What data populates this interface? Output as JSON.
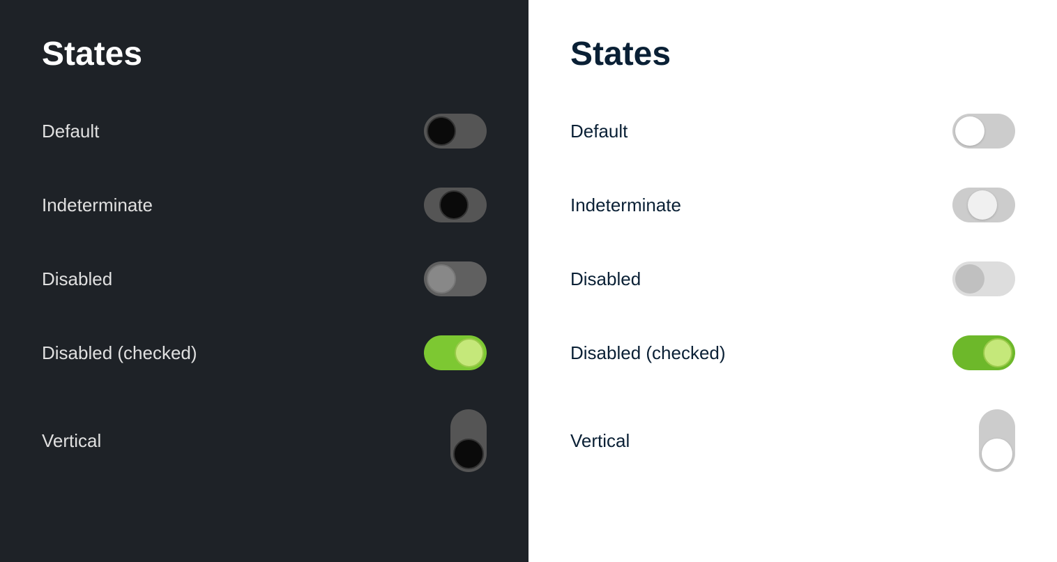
{
  "dark_panel": {
    "title": "States",
    "rows": [
      {
        "label": "Default",
        "toggle_class": "dark-default",
        "type": "horizontal"
      },
      {
        "label": "Indeterminate",
        "toggle_class": "dark-indeterminate",
        "type": "horizontal"
      },
      {
        "label": "Disabled",
        "toggle_class": "dark-disabled",
        "type": "horizontal"
      },
      {
        "label": "Disabled (checked)",
        "toggle_class": "dark-disabled-checked",
        "type": "horizontal"
      },
      {
        "label": "Vertical",
        "toggle_class": "dark-vertical",
        "type": "vertical"
      }
    ]
  },
  "light_panel": {
    "title": "States",
    "rows": [
      {
        "label": "Default",
        "toggle_class": "light-default",
        "type": "horizontal"
      },
      {
        "label": "Indeterminate",
        "toggle_class": "light-indeterminate",
        "type": "horizontal"
      },
      {
        "label": "Disabled",
        "toggle_class": "light-disabled",
        "type": "horizontal"
      },
      {
        "label": "Disabled (checked)",
        "toggle_class": "light-disabled-checked",
        "type": "horizontal"
      },
      {
        "label": "Vertical",
        "toggle_class": "light-vertical",
        "type": "vertical"
      }
    ]
  }
}
